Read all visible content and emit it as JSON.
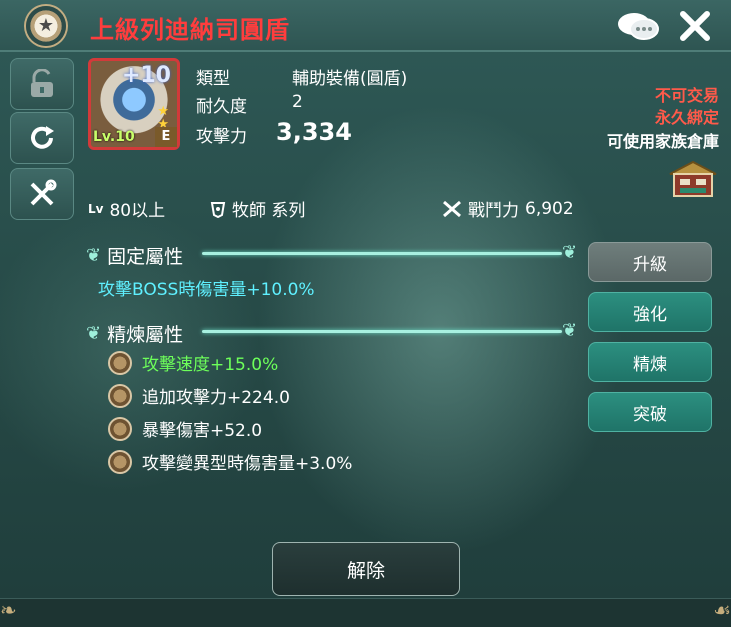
{
  "window": {
    "title": "上級列迪納司圓盾"
  },
  "item": {
    "enhance_level": "+10",
    "level_label": "Lv.10",
    "grade": "E",
    "star_count": 2
  },
  "details": {
    "type_label": "類型",
    "type_value": "輔助裝備(圓盾)",
    "durability_label": "耐久度",
    "durability_value": "2",
    "attack_label": "攻擊力",
    "attack_value": "3,334"
  },
  "restrictions": {
    "not_tradable": "不可交易",
    "bound": "永久綁定",
    "family_storage": "可使用家族倉庫"
  },
  "requirements": {
    "level_icon": "Lv",
    "level_value": "80以上",
    "class_value": "牧師 系列",
    "power_label": "戰鬥力",
    "power_value": "6,902"
  },
  "fixed_section": {
    "heading": "固定屬性",
    "attr": "攻擊BOSS時傷害量+10.0%"
  },
  "refine_section": {
    "heading": "精煉屬性",
    "attrs": [
      {
        "text": "攻擊速度+15.0%",
        "color": "#6dff5a"
      },
      {
        "text": "追加攻擊力+224.0",
        "color": "#ffffff"
      },
      {
        "text": "暴擊傷害+52.0",
        "color": "#ffffff"
      },
      {
        "text": "攻擊變異型時傷害量+3.0%",
        "color": "#ffffff"
      }
    ]
  },
  "actions": {
    "upgrade": "升級",
    "strengthen": "強化",
    "refine": "精煉",
    "breakthrough": "突破",
    "release": "解除"
  },
  "colors": {
    "title_red": "#ff3d3d",
    "attr_cyan": "#5ff0ff",
    "attr_green": "#6dff5a",
    "teal_button": "#2c8f80"
  }
}
